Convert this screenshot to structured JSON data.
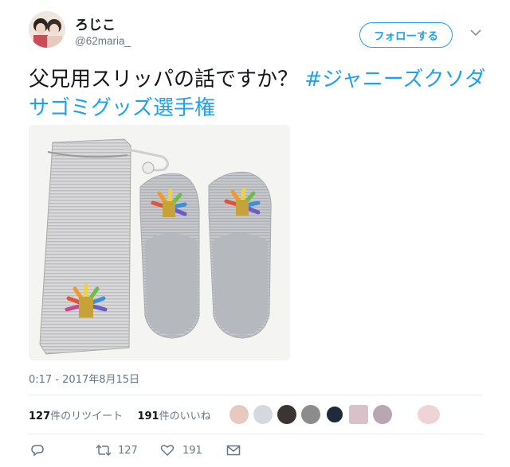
{
  "user": {
    "display_name": "ろじこ",
    "handle": "@62maria_"
  },
  "follow_button_label": "フォローする",
  "tweet": {
    "text": "父兄用スリッパの話ですか？",
    "hashtag": "#ジャニーズクソダサゴミグッズ選手権"
  },
  "timestamp": "0:17 - 2017年8月15日",
  "stats": {
    "retweets_count": "127",
    "retweets_label": "件のリツイート",
    "likes_count": "191",
    "likes_label": "件のいいね"
  },
  "actions": {
    "retweet_count": "127",
    "like_count": "191"
  },
  "icons": [
    "chevron-down-icon",
    "reply-icon",
    "retweet-icon",
    "like-icon",
    "message-icon"
  ],
  "colors": {
    "accent": "#1da1f2",
    "muted": "#657786",
    "text": "#14171a"
  }
}
